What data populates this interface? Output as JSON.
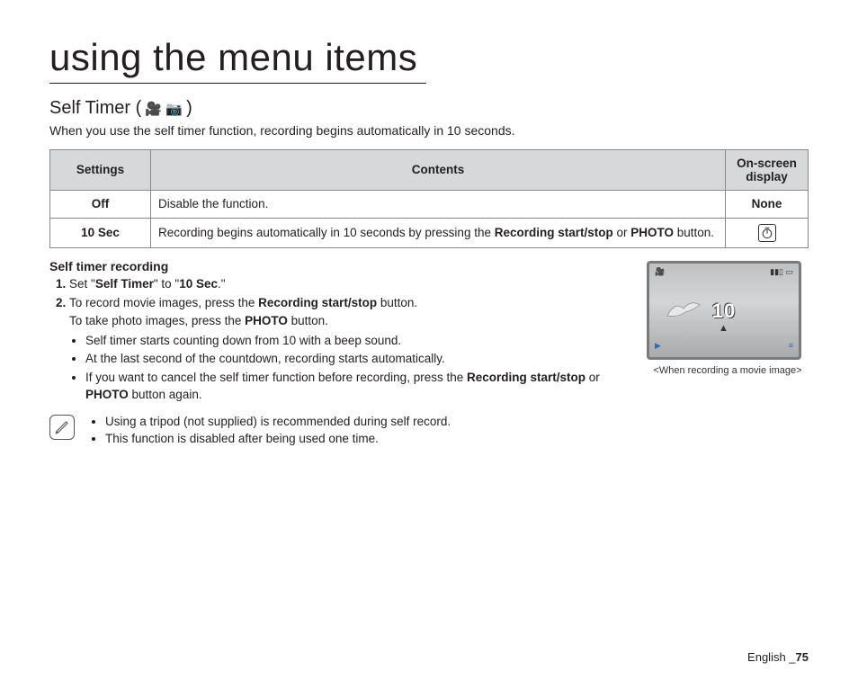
{
  "page_title": "using the menu items",
  "section": {
    "heading": "Self Timer (",
    "heading_icons": " 🎥 📷 ",
    "heading_close": ")",
    "intro": "When you use the self timer function, recording begins automatically in 10 seconds."
  },
  "table": {
    "headers": {
      "settings": "Settings",
      "contents": "Contents",
      "display": "On-screen display"
    },
    "rows": [
      {
        "setting": "Off",
        "contents_plain": "Disable the function.",
        "display_text": "None",
        "display_is_icon": false
      },
      {
        "setting": "10 Sec",
        "contents_parts": [
          {
            "t": "Recording begins automatically in 10 seconds by pressing the "
          },
          {
            "b": "Recording start/stop"
          },
          {
            "t": " or "
          },
          {
            "b": "PHOTO"
          },
          {
            "t": " button."
          }
        ],
        "display_is_icon": true,
        "display_icon_name": "timer-icon"
      }
    ]
  },
  "sub_heading": "Self timer recording",
  "steps": {
    "s1": {
      "pre": "Set \"",
      "b1": "Self Timer",
      "mid": "\" to \"",
      "b2": "10 Sec",
      "post": ".\""
    },
    "s2": {
      "line1_pre": "To record movie images, press the ",
      "line1_b": "Recording start/stop",
      "line1_post": " button.",
      "line2_pre": "To take photo images, press the ",
      "line2_b": "PHOTO",
      "line2_post": " button.",
      "bullets": [
        {
          "text": "Self timer starts counting down from 10 with a beep sound."
        },
        {
          "text": "At the last second of the countdown, recording starts automatically."
        },
        {
          "pre": "If you want to cancel the self timer function before recording, press the ",
          "b1": "Recording start/stop",
          "mid": " or ",
          "b2": "PHOTO",
          "post": " button again."
        }
      ]
    }
  },
  "notes": [
    "Using a tripod (not supplied) is recommended during self record.",
    "This function is disabled after being used one time."
  ],
  "screen": {
    "countdown": "10",
    "caption": "<When recording a movie image>"
  },
  "footer": {
    "lang": "English _",
    "page": "75"
  }
}
